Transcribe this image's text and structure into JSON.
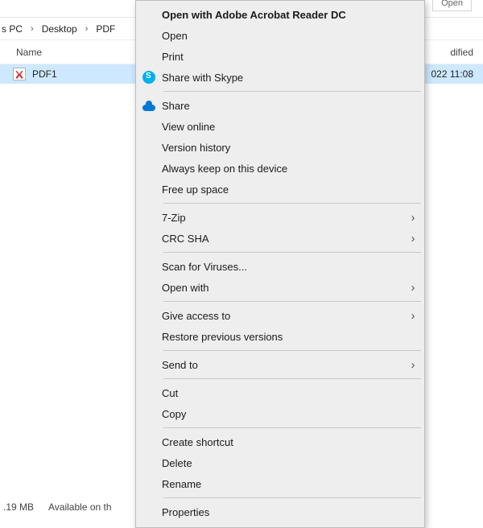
{
  "toolbar": {
    "open_label": "Open"
  },
  "breadcrumb": {
    "part1": "s PC",
    "part2": "Desktop",
    "part3": "PDF"
  },
  "columns": {
    "name": "Name",
    "date_modified": "dified"
  },
  "file": {
    "name": "PDF1",
    "date_modified": "022 11:08"
  },
  "status": {
    "size": ".19 MB",
    "availability": "Available on th"
  },
  "context_menu": {
    "open_adobe": "Open with Adobe Acrobat Reader DC",
    "open": "Open",
    "print": "Print",
    "share_skype": "Share with Skype",
    "share": "Share",
    "view_online": "View online",
    "version_history": "Version history",
    "always_keep": "Always keep on this device",
    "free_up": "Free up space",
    "seven_zip": "7-Zip",
    "crc_sha": "CRC SHA",
    "scan_viruses": "Scan for Viruses...",
    "open_with": "Open with",
    "give_access": "Give access to",
    "restore_prev": "Restore previous versions",
    "send_to": "Send to",
    "cut": "Cut",
    "copy": "Copy",
    "create_shortcut": "Create shortcut",
    "delete": "Delete",
    "rename": "Rename",
    "properties": "Properties"
  }
}
